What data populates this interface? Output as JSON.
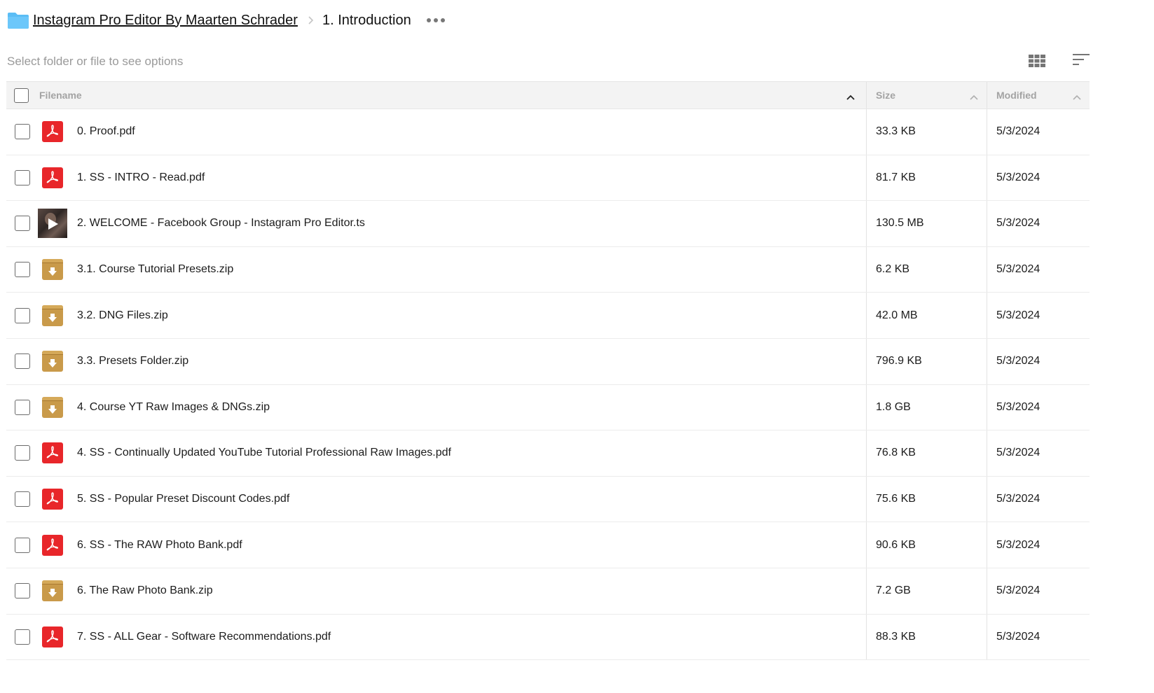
{
  "breadcrumb": {
    "root": "Instagram Pro Editor By Maarten Schrader",
    "current": "1. Introduction"
  },
  "toolbar": {
    "hint": "Select folder or file to see options"
  },
  "table": {
    "columns": {
      "name": "Filename",
      "size": "Size",
      "modified": "Modified"
    },
    "rows": [
      {
        "icon": "pdf-icon",
        "name": "0. Proof.pdf",
        "size": "33.3 KB",
        "modified": "5/3/2024"
      },
      {
        "icon": "pdf-icon",
        "name": "1. SS - INTRO - Read.pdf",
        "size": "81.7 KB",
        "modified": "5/3/2024"
      },
      {
        "icon": "video-thumbnail",
        "name": "2. WELCOME - Facebook Group - Instagram Pro Editor.ts",
        "size": "130.5 MB",
        "modified": "5/3/2024"
      },
      {
        "icon": "zip-icon",
        "name": "3.1. Course Tutorial Presets.zip",
        "size": "6.2 KB",
        "modified": "5/3/2024"
      },
      {
        "icon": "zip-icon",
        "name": "3.2. DNG Files.zip",
        "size": "42.0 MB",
        "modified": "5/3/2024"
      },
      {
        "icon": "zip-icon",
        "name": "3.3. Presets Folder.zip",
        "size": "796.9 KB",
        "modified": "5/3/2024"
      },
      {
        "icon": "zip-icon",
        "name": "4. Course YT Raw Images & DNGs.zip",
        "size": "1.8 GB",
        "modified": "5/3/2024"
      },
      {
        "icon": "pdf-icon",
        "name": "4. SS - Continually Updated YouTube Tutorial Professional Raw Images.pdf",
        "size": "76.8 KB",
        "modified": "5/3/2024"
      },
      {
        "icon": "pdf-icon",
        "name": "5. SS - Popular Preset Discount Codes.pdf",
        "size": "75.6 KB",
        "modified": "5/3/2024"
      },
      {
        "icon": "pdf-icon",
        "name": "6. SS - The RAW Photo Bank.pdf",
        "size": "90.6 KB",
        "modified": "5/3/2024"
      },
      {
        "icon": "zip-icon",
        "name": "6. The Raw Photo Bank.zip",
        "size": "7.2 GB",
        "modified": "5/3/2024"
      },
      {
        "icon": "pdf-icon",
        "name": "7. SS - ALL Gear - Software Recommendations.pdf",
        "size": "88.3 KB",
        "modified": "5/3/2024"
      }
    ]
  },
  "colors": {
    "folder": "#5bbdf5",
    "pdf": "#e8262a",
    "zip": "#c99a4a",
    "header_bg": "#f3f3f3"
  }
}
